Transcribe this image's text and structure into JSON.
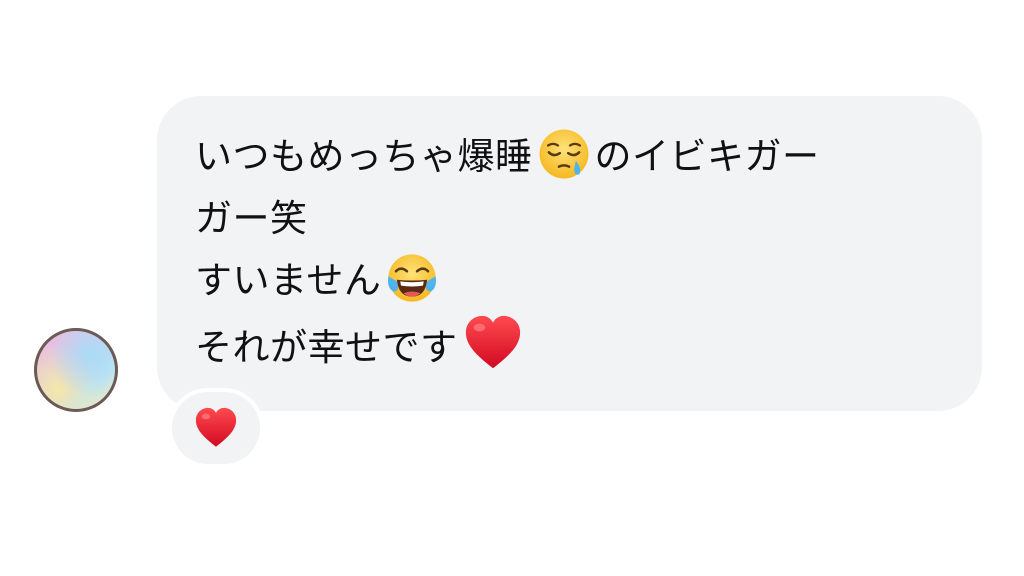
{
  "message": {
    "lines": [
      {
        "text_before": "いつもめっちゃ爆睡",
        "emoji": "sleepy-face-icon",
        "text_after": "のイビキガー"
      },
      {
        "text": "ガー笑"
      },
      {
        "text_before": "すいません",
        "emoji": "face-with-tears-of-joy-icon"
      },
      {
        "text_before": "それが幸せです",
        "emoji": "red-heart-icon"
      }
    ]
  },
  "reaction": {
    "emoji": "red-heart-icon"
  },
  "colors": {
    "bubble_bg": "#f2f3f5",
    "text": "#111111",
    "heart": "#e0132a",
    "emoji_yellow": "#ffcc3d"
  }
}
